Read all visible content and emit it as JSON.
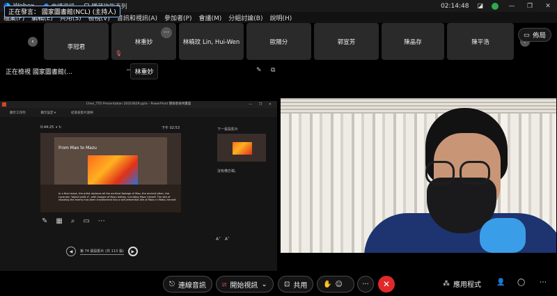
{
  "titlebar": {
    "app_name": "Webex",
    "meeting_info": "會議資訊",
    "hidden_features": "隱藏功能表列",
    "time": "02:14:48"
  },
  "menu": [
    "檔案(F)",
    "編輯(E)",
    "共用(S)",
    "檢視(V)",
    "音訊和視訊(A)",
    "參加者(P)",
    "會議(M)",
    "分組討論(B)",
    "說明(H)"
  ],
  "strip": {
    "speaker": "正在發言： 國家圖書館(NCL) (主持人)",
    "participants": [
      "李冠君",
      "林重妙",
      "林曉玟 Lin, Hui-Wen",
      "歐陽分",
      "郭宣芳",
      "陳晶存",
      "陳平浩"
    ],
    "layout_label": "佈局"
  },
  "viewing": {
    "label": "正在檢視 國家圖書館(...",
    "tooltip": "林重妙"
  },
  "ppt": {
    "window_title": "Chen_TTD Presentation 20210629.pptx - PowerPoint 簡報者檢視畫面",
    "toolbar": [
      "顯示工作列",
      "顯示設定 ▾",
      "結束投影片放映"
    ],
    "timer": "0:44:25",
    "clock": "下午 02:53",
    "slide_title": "From Mao to Mazu",
    "slide_text": "In a final move, the artist replaces all the archival footage of Mao, the ancient other, the Lacanian \"object petit a\", with images of Mazu deities, including Mazu herself. The site of shooting the enemy has been transformed into a self-referential site of Mazu in Matsu herself.",
    "slide_counter": "第 74 張投影片 (共 113 張)",
    "next_label": "下一張投影片",
    "notes": "沒有備忘稿。"
  },
  "controls": {
    "audio": "連線音訊",
    "video": "開始視訊",
    "share": "共用",
    "apps": "應用程式"
  }
}
